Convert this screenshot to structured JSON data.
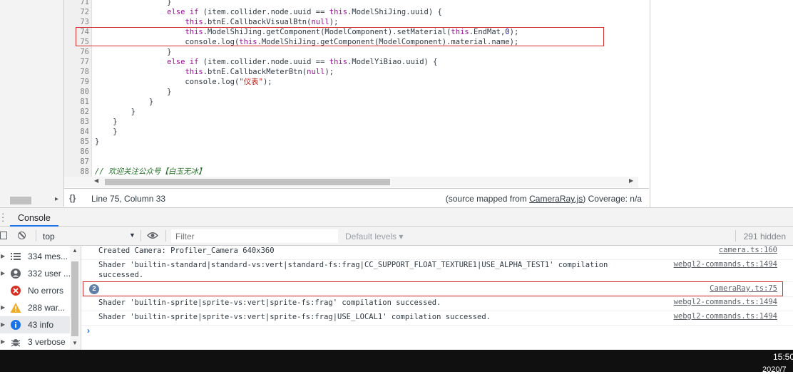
{
  "editor": {
    "lines": [
      {
        "num": "71",
        "text": "                }"
      },
      {
        "num": "72",
        "text": "                else if (item.collider.node.uuid == this.ModelShiJing.uuid) {"
      },
      {
        "num": "73",
        "text": "                    this.btnE.CallbackVisualBtn(null);"
      },
      {
        "num": "74",
        "text": "                    this.ModelShiJing.getComponent(ModelComponent).setMaterial(this.EndMat,0);"
      },
      {
        "num": "75",
        "text": "                    console.log(this.ModelShiJing.getComponent(ModelComponent).material.name);"
      },
      {
        "num": "76",
        "text": "                }"
      },
      {
        "num": "77",
        "text": "                else if (item.collider.node.uuid == this.ModelYiBiao.uuid) {"
      },
      {
        "num": "78",
        "text": "                    this.btnE.CallbackMeterBtn(null);"
      },
      {
        "num": "79",
        "text": "                    console.log(\"仪表\");"
      },
      {
        "num": "80",
        "text": "                }"
      },
      {
        "num": "81",
        "text": "            }"
      },
      {
        "num": "82",
        "text": "        }"
      },
      {
        "num": "83",
        "text": "    }"
      },
      {
        "num": "84",
        "text": "    }"
      },
      {
        "num": "85",
        "text": "}"
      },
      {
        "num": "86",
        "text": ""
      },
      {
        "num": "87",
        "text": ""
      },
      {
        "num": "88",
        "text": "// 欢迎关注公众号【白玉无冰】"
      }
    ]
  },
  "status_bar": {
    "braces_icon": "{}",
    "position": "Line 75, Column 33",
    "source_prefix": "(source mapped from ",
    "source_file": "CameraRay.js",
    "source_suffix": ") Coverage: n/a"
  },
  "drawer": {
    "tab_label": "Console"
  },
  "toolbar": {
    "context": "top",
    "filter_placeholder": "Filter",
    "levels": "Default levels ▾",
    "hidden_count": "291 hidden"
  },
  "sidebar": {
    "items": [
      {
        "label": "334 mes...",
        "icon": "list-icon"
      },
      {
        "label": "332 user ...",
        "icon": "user-icon"
      },
      {
        "label": "No errors",
        "icon": "error-icon"
      },
      {
        "label": "288 war...",
        "icon": "warning-icon"
      },
      {
        "label": "43 info",
        "icon": "info-icon"
      },
      {
        "label": "3 verbose",
        "icon": "bug-icon"
      }
    ]
  },
  "messages": [
    {
      "text": "Created Camera: Profiler_Camera 640x360",
      "source": "camera.ts:160"
    },
    {
      "text": "Shader 'builtin-standard|standard-vs:vert|standard-fs:frag|CC_SUPPORT_FLOAT_TEXTURE1|USE_ALPHA_TEST1' compilation\nsuccessed.",
      "source": "webgl2-commands.ts:1494"
    },
    {
      "text": "",
      "badge": "2",
      "source": "CameraRay.ts:75"
    },
    {
      "text": "Shader 'builtin-sprite|sprite-vs:vert|sprite-fs:frag' compilation successed.",
      "source": "webgl2-commands.ts:1494"
    },
    {
      "text": "Shader 'builtin-sprite|sprite-vs:vert|sprite-fs:frag|USE_LOCAL1' compilation successed.",
      "source": "webgl2-commands.ts:1494"
    }
  ],
  "prompt_symbol": "›",
  "taskbar": {
    "time": "15:50",
    "date": "2020/7"
  },
  "colors": {
    "highlight_box": "#d32f2f",
    "accent": "#1a73e8",
    "error": "#d93025",
    "warning": "#f2ab26",
    "info": "#1a73e8"
  }
}
